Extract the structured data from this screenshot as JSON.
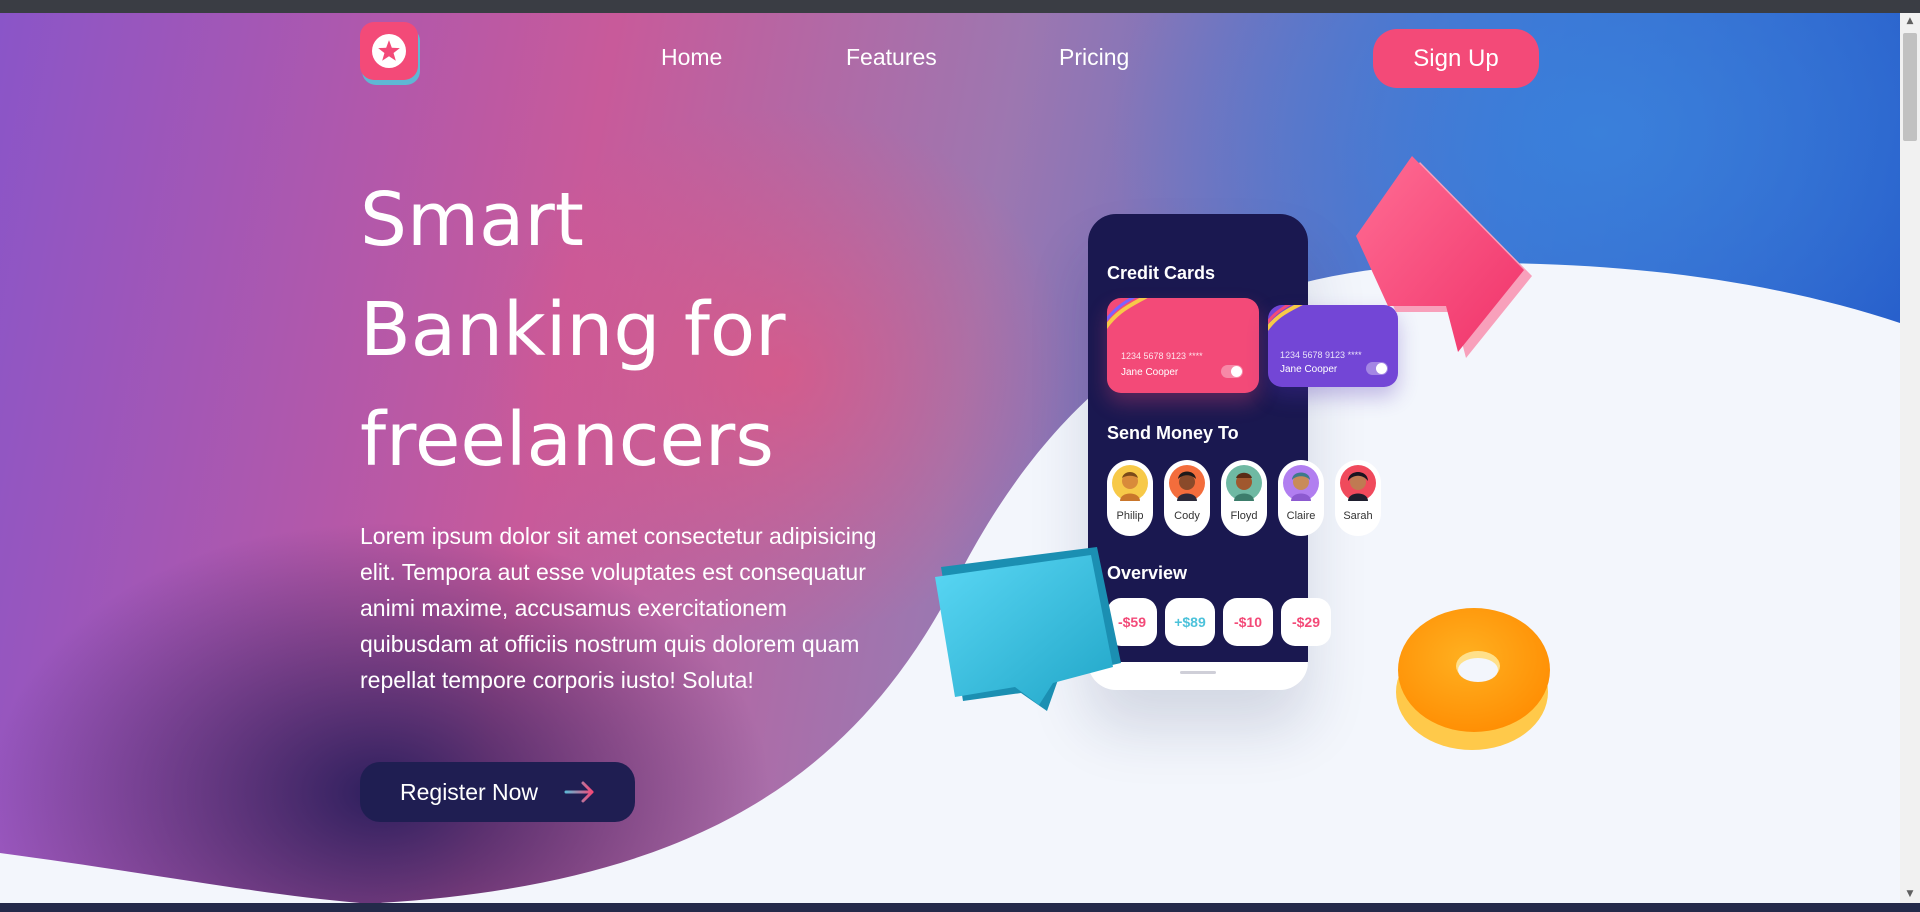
{
  "nav": {
    "links": [
      "Home",
      "Features",
      "Pricing"
    ],
    "signup_label": "Sign Up"
  },
  "hero": {
    "headline_lines": [
      "Smart",
      "Banking for",
      "freelancers"
    ],
    "paragraph": "Lorem ipsum dolor sit amet consectetur adipisicing elit. Tempora aut esse voluptates est consequatur animi maxime, accusamus exercitationem quibusdam at officiis nostrum quis dolorem quam repellat tempore corporis iusto! Soluta!",
    "register_label": "Register Now"
  },
  "phone": {
    "credit_cards_title": "Credit Cards",
    "cards": [
      {
        "number": "1234 5678 9123 ****",
        "holder": "Jane Cooper",
        "color": "#f34a78"
      },
      {
        "number": "1234 5678 9123 ****",
        "holder": "Jane Cooper",
        "color": "#7346d6"
      }
    ],
    "send_money_title": "Send Money To",
    "contacts": [
      "Philip",
      "Cody",
      "Floyd",
      "Claire",
      "Sarah"
    ],
    "overview_title": "Overview",
    "amounts": [
      {
        "text": "-$59",
        "color": "#f34a78"
      },
      {
        "text": "+$89",
        "color": "#4cc2da"
      },
      {
        "text": "-$10",
        "color": "#f34a78"
      },
      {
        "text": "-$29",
        "color": "#f34a78"
      }
    ]
  },
  "colors": {
    "accent_pink": "#f34a78",
    "navy": "#1f1e52",
    "page_bg": "#f3f6fc"
  },
  "icons": [
    "star-logo-icon",
    "arrow-right-icon"
  ]
}
